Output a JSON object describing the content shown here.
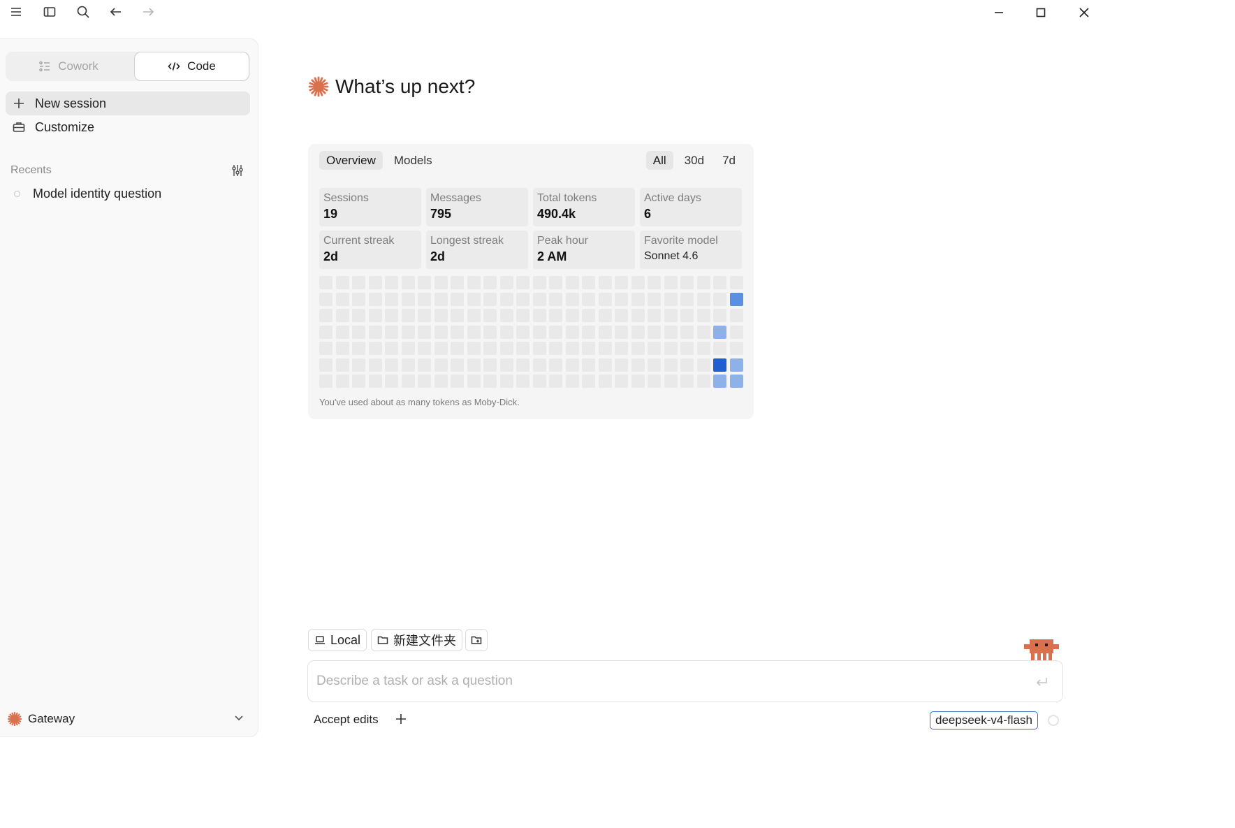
{
  "titlebar": {
    "icons": [
      "menu-icon",
      "sidebar-toggle-icon",
      "search-icon",
      "back-arrow-icon",
      "forward-arrow-icon"
    ],
    "window_controls": [
      "minimize-icon",
      "maximize-icon",
      "close-icon"
    ]
  },
  "sidebar": {
    "mode_cowork_label": "Cowork",
    "mode_code_label": "Code",
    "new_session_label": "New session",
    "customize_label": "Customize",
    "recents_label": "Recents",
    "recents": [
      {
        "label": "Model identity question"
      }
    ],
    "gateway_label": "Gateway"
  },
  "main": {
    "title": "What’s up next?",
    "accent_color": "#d9714e"
  },
  "stats": {
    "tabs": [
      {
        "label": "Overview",
        "active": true
      },
      {
        "label": "Models",
        "active": false
      }
    ],
    "ranges": [
      {
        "label": "All",
        "active": true
      },
      {
        "label": "30d",
        "active": false
      },
      {
        "label": "7d",
        "active": false
      }
    ],
    "cards": [
      {
        "label": "Sessions",
        "value": "19"
      },
      {
        "label": "Messages",
        "value": "795"
      },
      {
        "label": "Total tokens",
        "value": "490.4k"
      },
      {
        "label": "Active days",
        "value": "6"
      },
      {
        "label": "Current streak",
        "value": "2d"
      },
      {
        "label": "Longest streak",
        "value": "2d"
      },
      {
        "label": "Peak hour",
        "value": "2 AM"
      },
      {
        "label": "Favorite model",
        "value": "Sonnet 4.6"
      }
    ],
    "heatmap": {
      "weeks": 26,
      "days": 7,
      "active_cells": [
        {
          "week": 25,
          "day": 1,
          "level": 2
        },
        {
          "week": 24,
          "day": 3,
          "level": 1
        },
        {
          "week": 24,
          "day": 5,
          "level": 4
        },
        {
          "week": 25,
          "day": 5,
          "level": 1
        },
        {
          "week": 24,
          "day": 6,
          "level": 1
        },
        {
          "week": 25,
          "day": 6,
          "level": 1
        }
      ],
      "level_colors": [
        "#e9e9e9",
        "#8fb1ea",
        "#5b8fdf",
        "#3f7adb",
        "#1f5fcf"
      ]
    },
    "note": "You've used about as many tokens as Moby-Dick."
  },
  "composer": {
    "local_label": "Local",
    "folder_label": "新建文件夹",
    "placeholder": "Describe a task or ask a question",
    "accept_edits_label": "Accept edits",
    "model_label": "deepseek-v4-flash"
  }
}
